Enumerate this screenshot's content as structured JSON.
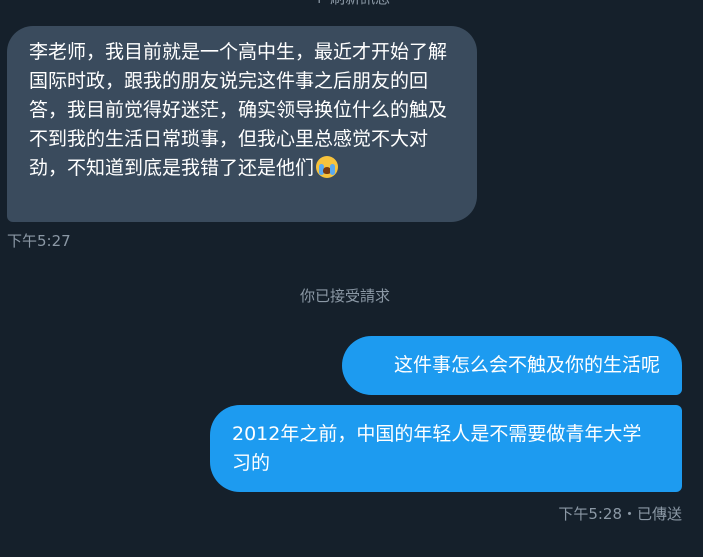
{
  "top_notice": "↑ 刷新訊息",
  "incoming_message": {
    "text": "李老师，我目前就是一个高中生，最近才开始了解国际时政，跟我的朋友说完这件事之后朋友的回答，我目前觉得好迷茫，确实领导换位什么的触及不到我的生活日常琐事，但我心里总感觉不大对劲，不知道到底是我错了还是他们",
    "emoji": "crying-face-icon",
    "time": "下午5:27"
  },
  "system_message": "你已接受請求",
  "outgoing_messages": [
    {
      "text": "这件事怎么会不触及你的生活呢"
    },
    {
      "text": "2012年之前，中国的年轻人是不需要做青年大学习的"
    }
  ],
  "outgoing_status": "下午5:28・已傳送",
  "colors": {
    "background": "#15202b",
    "incoming_bubble": "#3a4b5d",
    "outgoing_bubble": "#1d9bf0",
    "muted_text": "#8b98a5"
  }
}
